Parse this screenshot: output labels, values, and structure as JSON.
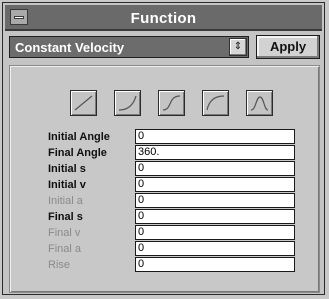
{
  "window": {
    "title": "Function"
  },
  "combo": {
    "value": "Constant Velocity",
    "arrow": "⇕"
  },
  "apply_label": "Apply",
  "shape_buttons": [
    {
      "icon": "linear-curve-icon"
    },
    {
      "icon": "accelerate-curve-icon"
    },
    {
      "icon": "s-curve-icon"
    },
    {
      "icon": "decelerate-curve-icon"
    },
    {
      "icon": "bell-curve-icon"
    }
  ],
  "params": [
    {
      "label": "Initial Angle",
      "value": "0",
      "enabled": true
    },
    {
      "label": "Final Angle",
      "value": "360.",
      "enabled": true
    },
    {
      "label": "Initial s",
      "value": "0",
      "enabled": true
    },
    {
      "label": "Initial v",
      "value": "0",
      "enabled": true
    },
    {
      "label": "Initial a",
      "value": "0",
      "enabled": false
    },
    {
      "label": "Final s",
      "value": "0",
      "enabled": true
    },
    {
      "label": "Final v",
      "value": "0",
      "enabled": false
    },
    {
      "label": "Final a",
      "value": "0",
      "enabled": false
    },
    {
      "label": "Rise",
      "value": "0",
      "enabled": false
    }
  ]
}
